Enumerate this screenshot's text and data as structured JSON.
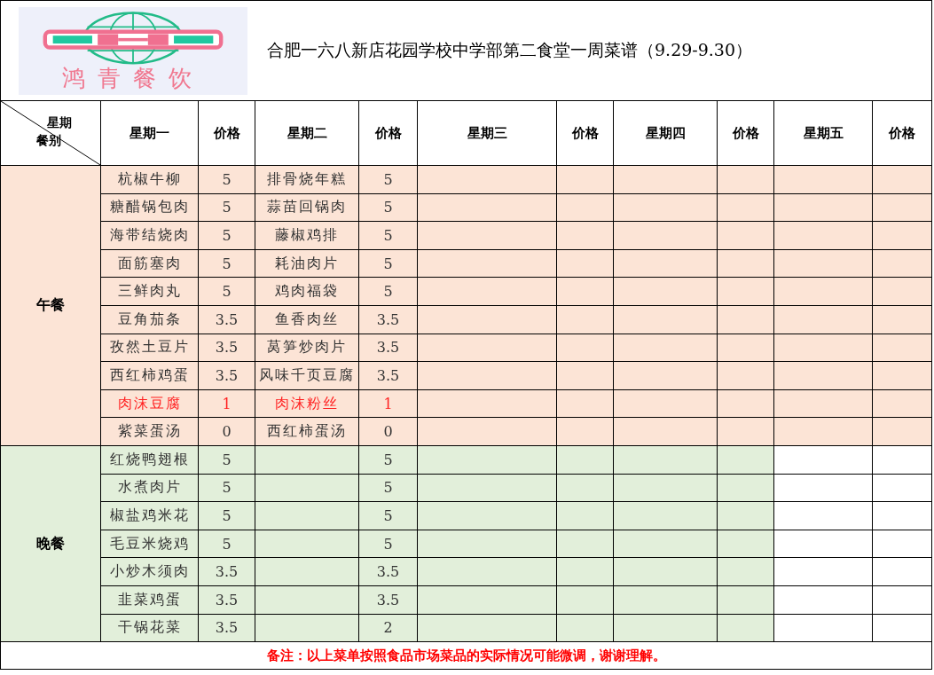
{
  "logo": {
    "text": "鸿青餐饮"
  },
  "title": "合肥一六八新店花园学校中学部第二食堂一周菜谱（9.29-9.30）",
  "corner": {
    "top": "星期",
    "bottom": "餐别"
  },
  "columns": [
    {
      "label": "星期一",
      "kind": "dish",
      "dinner_shaded": true
    },
    {
      "label": "价格",
      "kind": "price",
      "dinner_shaded": true
    },
    {
      "label": "星期二",
      "kind": "dish",
      "dinner_shaded": true
    },
    {
      "label": "价格",
      "kind": "price",
      "dinner_shaded": true
    },
    {
      "label": "星期三",
      "kind": "dish",
      "dinner_shaded": true
    },
    {
      "label": "价格",
      "kind": "price",
      "dinner_shaded": true
    },
    {
      "label": "星期四",
      "kind": "dish",
      "dinner_shaded": true
    },
    {
      "label": "价格",
      "kind": "price",
      "dinner_shaded": true
    },
    {
      "label": "星期五",
      "kind": "dish",
      "dinner_shaded": false
    },
    {
      "label": "价格",
      "kind": "price",
      "dinner_shaded": false
    }
  ],
  "meals": [
    {
      "name": "午餐",
      "kind": "lunch",
      "rows": [
        {
          "highlight": false,
          "cells": [
            "杭椒牛柳",
            "5",
            "排骨烧年糕",
            "5"
          ]
        },
        {
          "highlight": false,
          "cells": [
            "糖醋锅包肉",
            "5",
            "蒜苗回锅肉",
            "5"
          ]
        },
        {
          "highlight": false,
          "cells": [
            "海带结烧肉",
            "5",
            "藤椒鸡排",
            "5"
          ]
        },
        {
          "highlight": false,
          "cells": [
            "面筋塞肉",
            "5",
            "耗油肉片",
            "5"
          ]
        },
        {
          "highlight": false,
          "cells": [
            "三鲜肉丸",
            "5",
            "鸡肉福袋",
            "5"
          ]
        },
        {
          "highlight": false,
          "cells": [
            "豆角茄条",
            "3.5",
            "鱼香肉丝",
            "3.5"
          ]
        },
        {
          "highlight": false,
          "cells": [
            "孜然土豆片",
            "3.5",
            "莴笋炒肉片",
            "3.5"
          ]
        },
        {
          "highlight": false,
          "cells": [
            "西红柿鸡蛋",
            "3.5",
            "风味千页豆腐",
            "3.5"
          ]
        },
        {
          "highlight": true,
          "cells": [
            "肉沫豆腐",
            "1",
            "肉沫粉丝",
            "1"
          ]
        },
        {
          "highlight": false,
          "cells": [
            "紫菜蛋汤",
            "0",
            "西红柿蛋汤",
            "0"
          ]
        }
      ]
    },
    {
      "name": "晚餐",
      "kind": "dinner",
      "rows": [
        {
          "highlight": false,
          "cells": [
            "红烧鸭翅根",
            "5",
            null,
            "5"
          ]
        },
        {
          "highlight": false,
          "cells": [
            "水煮肉片",
            "5",
            null,
            "5"
          ]
        },
        {
          "highlight": false,
          "cells": [
            "椒盐鸡米花",
            "5",
            null,
            "5"
          ]
        },
        {
          "highlight": false,
          "cells": [
            "毛豆米烧鸡",
            "5",
            null,
            "5"
          ]
        },
        {
          "highlight": false,
          "cells": [
            "小炒木须肉",
            "3.5",
            null,
            "3.5"
          ]
        },
        {
          "highlight": false,
          "cells": [
            "韭菜鸡蛋",
            "3.5",
            null,
            "3.5"
          ]
        },
        {
          "highlight": false,
          "cells": [
            "干锅花菜",
            "3.5",
            null,
            "2"
          ]
        }
      ]
    }
  ],
  "note": "备注：以上菜单按照食品市场菜品的实际情况可能微调，谢谢理解。"
}
